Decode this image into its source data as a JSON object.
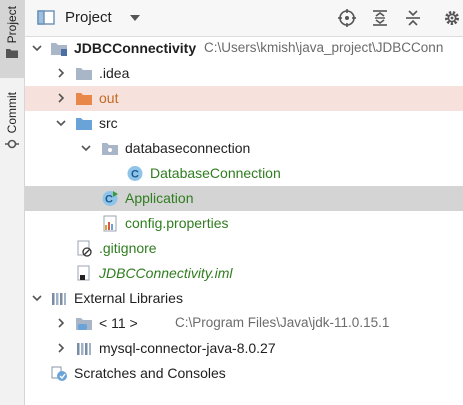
{
  "sidebar": {
    "project_tab": "Project",
    "commit_tab": "Commit"
  },
  "header": {
    "title": "Project"
  },
  "tree": {
    "root_name": "JDBCConnectivity",
    "root_path": "C:\\Users\\kmish\\java_project\\JDBCConn",
    "idea": ".idea",
    "out": "out",
    "src": "src",
    "package": "databaseconnection",
    "class_database": "DatabaseConnection",
    "class_application": "Application",
    "config": "config.properties",
    "gitignore": ".gitignore",
    "iml": "JDBCConnectivity.iml",
    "external_libraries": "External Libraries",
    "jdk_label": "< 11 >",
    "jdk_path": "C:\\Program Files\\Java\\jdk-11.0.15.1",
    "mysql": "mysql-connector-java-8.0.27",
    "scratches": "Scratches and Consoles"
  },
  "colors": {
    "green_text": "#2f7d1f",
    "excluded_bg": "#f6e1dc",
    "selected_bg": "#d4d4d4",
    "folder_blue": "#6aa3d8",
    "folder_orange": "#e8874a"
  }
}
